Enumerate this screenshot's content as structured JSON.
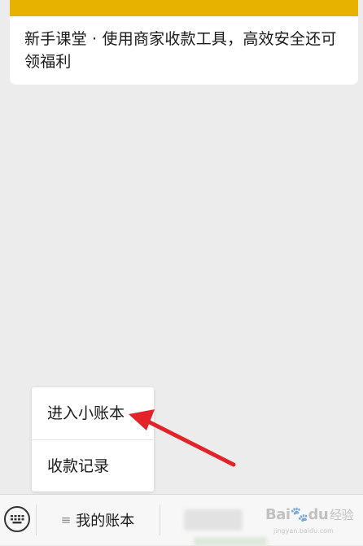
{
  "article": {
    "title": "新手课堂 · 使用商家收款工具，高效安全还可领福利"
  },
  "popup_menu": {
    "items": [
      {
        "label": "进入小账本"
      },
      {
        "label": "收款记录"
      }
    ]
  },
  "bottom_bar": {
    "menu_label": "我的账本",
    "menu_icon": "hamburger-icon",
    "keyboard_icon": "keyboard-icon"
  },
  "watermark": {
    "brand": "Bai",
    "brand_suffix": "du",
    "jingyan": "经验",
    "url": "jingyan.baidu.com"
  },
  "colors": {
    "banner": "#e8b200",
    "arrow": "#e0242a",
    "background": "#ececec"
  }
}
